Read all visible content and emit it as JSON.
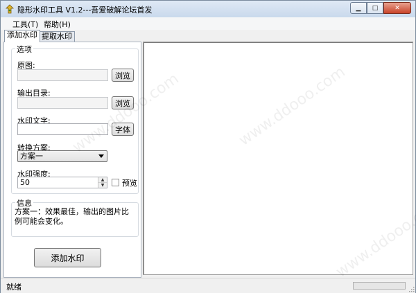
{
  "window": {
    "title": "隐形水印工具 V1.2---吾爱破解论坛首发",
    "controls": {
      "minimize": "▁",
      "maximize": "□",
      "close": "✕"
    }
  },
  "menu": [
    {
      "label": "工具(T)"
    },
    {
      "label": "帮助(H)"
    }
  ],
  "tabs": [
    {
      "label": "添加水印",
      "active": true
    },
    {
      "label": "提取水印",
      "active": false
    }
  ],
  "options": {
    "group_label": "选项",
    "original_label": "原图:",
    "original_value": "",
    "browse_original": "浏览",
    "output_label": "输出目录:",
    "output_value": "",
    "browse_output": "浏览",
    "text_label": "水印文字:",
    "text_value": "",
    "font_button": "字体",
    "scheme_label": "转换方案:",
    "scheme_value": "方案一",
    "strength_label": "水印强度:",
    "strength_value": "50",
    "preview_label": "预览",
    "preview_checked": false
  },
  "info": {
    "group_label": "信息",
    "text": "方案一：效果最佳，输出的图片比例可能会变化。"
  },
  "add_button": "添加水印",
  "status": {
    "text": "就绪",
    "progress": 0
  }
}
